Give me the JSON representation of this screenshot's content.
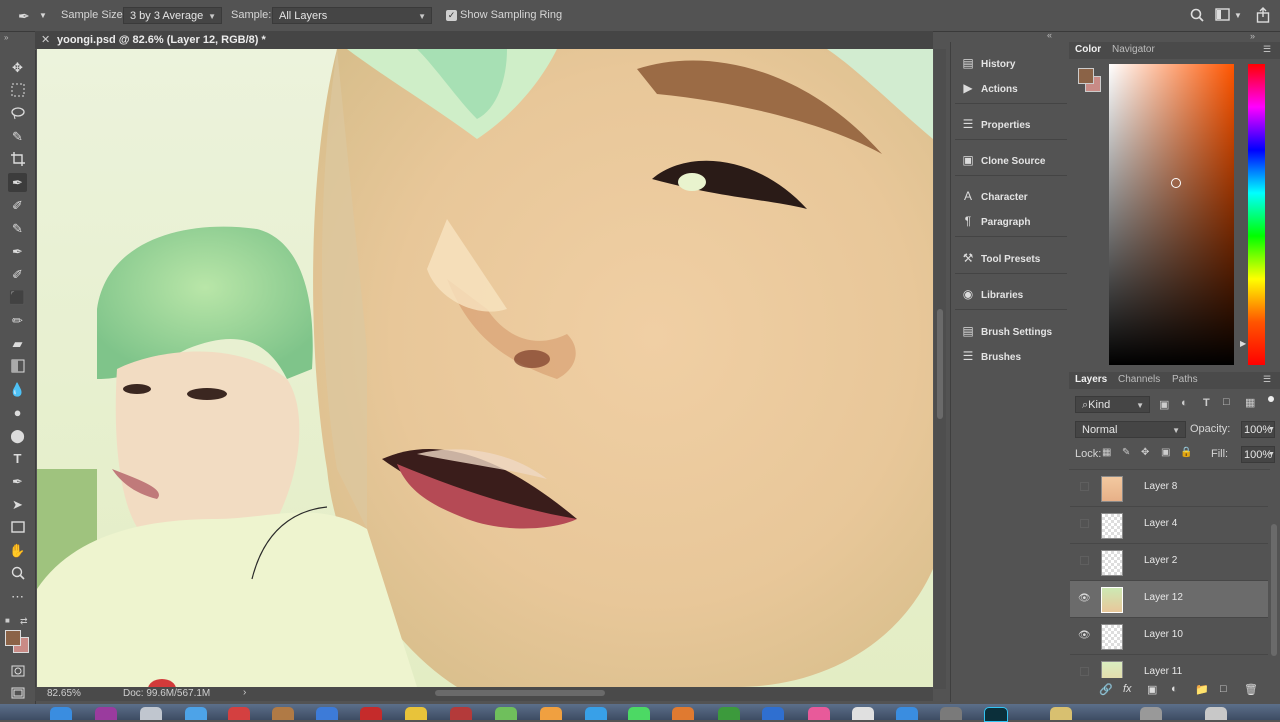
{
  "options_bar": {
    "sample_size_label": "Sample Size:",
    "sample_size_value": "3 by 3 Average",
    "sample_label": "Sample:",
    "sample_value": "All Layers",
    "show_sampling_ring_label": "Show Sampling Ring",
    "show_sampling_ring_checked": true
  },
  "document": {
    "tab_title": "yoongi.psd @ 82.6% (Layer 12, RGB/8) *",
    "zoom_status": "82.65%",
    "doc_size": "Doc: 99.6M/567.1M"
  },
  "dock": {
    "items": [
      {
        "label": "History",
        "icon": "history-icon"
      },
      {
        "label": "Actions",
        "icon": "play-icon"
      },
      {
        "label": "Properties",
        "icon": "properties-icon"
      },
      {
        "label": "Clone Source",
        "icon": "clone-source-icon"
      },
      {
        "label": "Character",
        "icon": "character-icon"
      },
      {
        "label": "Paragraph",
        "icon": "paragraph-icon"
      },
      {
        "label": "Tool Presets",
        "icon": "tool-presets-icon"
      },
      {
        "label": "Libraries",
        "icon": "libraries-icon"
      },
      {
        "label": "Brush Settings",
        "icon": "brush-settings-icon"
      },
      {
        "label": "Brushes",
        "icon": "brushes-icon"
      }
    ]
  },
  "color_panel": {
    "tabs": [
      "Color",
      "Navigator"
    ],
    "foreground_color": "#8b6347",
    "background_color": "#c98b86",
    "hue_color": "#ff5500"
  },
  "layers_panel": {
    "tabs": [
      "Layers",
      "Channels",
      "Paths"
    ],
    "filter_kind": "Kind",
    "blend_mode": "Normal",
    "opacity_label": "Opacity:",
    "opacity_value": "100%",
    "lock_label": "Lock:",
    "fill_label": "Fill:",
    "fill_value": "100%",
    "layers": [
      {
        "name": "Layer 8",
        "visible": false,
        "selected": false
      },
      {
        "name": "Layer 4",
        "visible": false,
        "selected": false
      },
      {
        "name": "Layer 2",
        "visible": false,
        "selected": false
      },
      {
        "name": "Layer 12",
        "visible": true,
        "selected": true
      },
      {
        "name": "Layer 10",
        "visible": true,
        "selected": false
      },
      {
        "name": "Layer 11",
        "visible": false,
        "selected": false
      }
    ]
  }
}
